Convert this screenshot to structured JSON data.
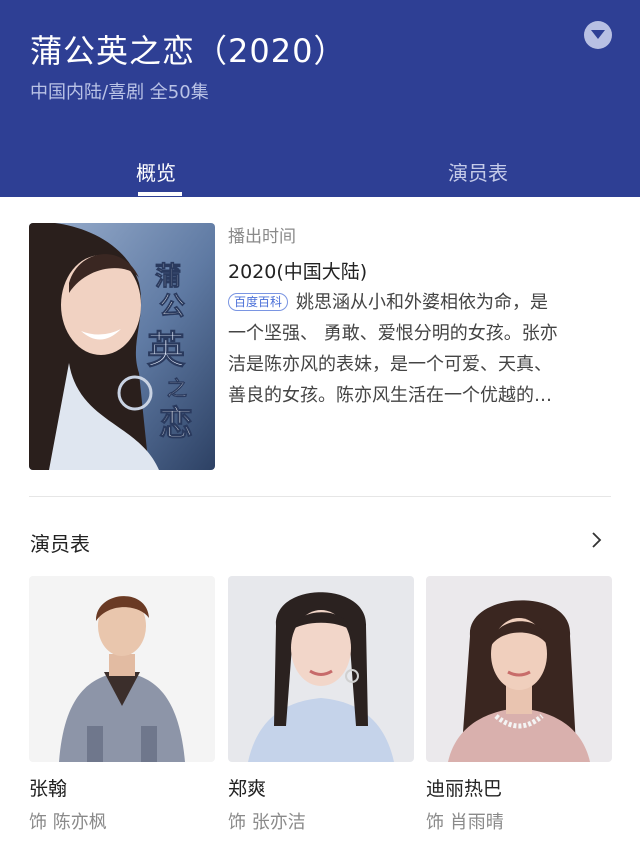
{
  "header": {
    "title": "蒲公英之恋（2020）",
    "subtitle": "中国内陆/喜剧 全50集",
    "collapse_icon": "chevron-down-circle-icon",
    "background_color": "#2e3f94"
  },
  "tabs": [
    {
      "label": "概览",
      "active": true
    },
    {
      "label": "演员表",
      "active": false
    }
  ],
  "overview": {
    "poster_text": [
      "蒲",
      "公",
      "英",
      "之",
      "恋"
    ],
    "air_label": "播出时间",
    "air_value": "2020(中国大陆)",
    "badge": "百度百科",
    "description_lines": [
      "姚思涵从小和外婆相依为命，是",
      "一个坚强、 勇敢、爱恨分明的女孩。张亦",
      "洁是陈亦风的表妹，是一个可爱、天真、",
      "善良的女孩。陈亦风生活在一个优越的…"
    ]
  },
  "cast": {
    "heading": "演员表",
    "more_icon": "chevron-right-icon",
    "members": [
      {
        "name": "张翰",
        "role": "饰 陈亦枫"
      },
      {
        "name": "郑爽",
        "role": "饰 张亦洁"
      },
      {
        "name": "迪丽热巴",
        "role": "饰 肖雨晴"
      }
    ]
  }
}
